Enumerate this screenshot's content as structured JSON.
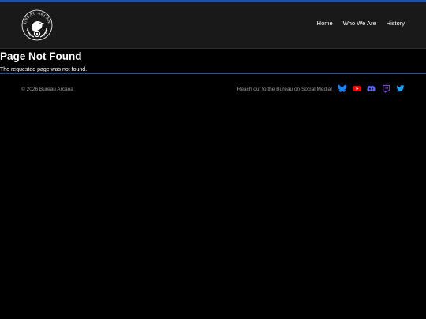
{
  "header": {
    "logo_text": "BUREAU ARCANA",
    "nav": [
      {
        "label": "Home"
      },
      {
        "label": "Who We Are"
      },
      {
        "label": "History"
      }
    ]
  },
  "main": {
    "title": "Page Not Found",
    "message": "The requested page was not found."
  },
  "footer": {
    "copyright": "© 2026 Bureau Arcana",
    "social_prompt": "Reach out to the Bureau on Social Media!",
    "social": [
      {
        "icon": "bluesky-icon",
        "color": "#1185fe"
      },
      {
        "icon": "youtube-icon",
        "color": "#ff0000"
      },
      {
        "icon": "discord-icon",
        "color": "#5865f2"
      },
      {
        "icon": "twitch-icon",
        "color": "#9146ff"
      },
      {
        "icon": "twitter-icon",
        "color": "#1da1f2"
      }
    ]
  },
  "colors": {
    "accent": "#1f4fa8",
    "header_bg": "#191919",
    "page_bg": "#000000"
  }
}
